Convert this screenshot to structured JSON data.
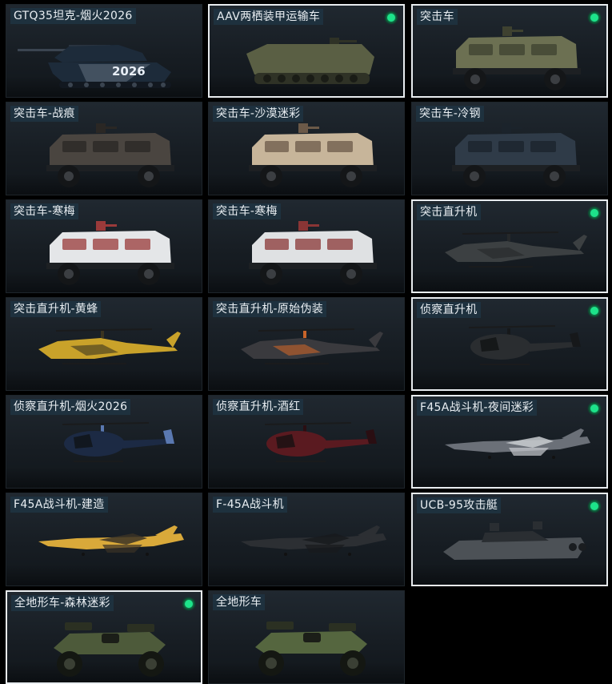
{
  "colors": {
    "card_bg": "#1b2229",
    "label_bg": "#1e3442",
    "selected_border": "#e8ecef",
    "badge": "#1de38a"
  },
  "items": [
    {
      "label": "GTQ35坦克-烟火2026",
      "selected": false,
      "badge": false,
      "icon": "tank-icon",
      "kind": "tank",
      "body": "#1d2b3a",
      "accent": "#b7c3d3",
      "decal": "2026"
    },
    {
      "label": "AAV两栖装甲运输车",
      "selected": true,
      "badge": true,
      "icon": "amphibious-carrier-icon",
      "kind": "aav",
      "body": "#5a5f44",
      "accent": "#2f3226"
    },
    {
      "label": "突击车",
      "selected": true,
      "badge": true,
      "icon": "assault-vehicle-icon",
      "kind": "truck",
      "body": "#6c7052",
      "accent": "#3e4130"
    },
    {
      "label": "突击车-战痕",
      "selected": false,
      "badge": false,
      "icon": "assault-vehicle-icon",
      "kind": "truck",
      "body": "#4a4540",
      "accent": "#2a2724"
    },
    {
      "label": "突击车-沙漠迷彩",
      "selected": false,
      "badge": false,
      "icon": "assault-vehicle-icon",
      "kind": "truck",
      "body": "#c7b59a",
      "accent": "#6b5948"
    },
    {
      "label": "突击车-冷钢",
      "selected": false,
      "badge": false,
      "icon": "assault-vehicle-icon",
      "kind": "truck",
      "body": "#2f3b48",
      "accent": "#1b232b"
    },
    {
      "label": "突击车-寒梅",
      "selected": false,
      "badge": false,
      "icon": "assault-vehicle-icon",
      "kind": "truck",
      "body": "#e4e6e8",
      "accent": "#9a3a3a"
    },
    {
      "label": "突击车-寒梅",
      "selected": false,
      "badge": false,
      "icon": "assault-vehicle-icon",
      "kind": "truck",
      "body": "#dfe1e3",
      "accent": "#8a3535"
    },
    {
      "label": "突击直升机",
      "selected": true,
      "badge": true,
      "icon": "attack-helicopter-icon",
      "kind": "heli",
      "body": "#3c4042",
      "accent": "#25282a"
    },
    {
      "label": "突击直升机-黄蜂",
      "selected": false,
      "badge": false,
      "icon": "attack-helicopter-icon",
      "kind": "heli",
      "body": "#c9a22a",
      "accent": "#3b3420"
    },
    {
      "label": "突击直升机-原始伪装",
      "selected": false,
      "badge": false,
      "icon": "attack-helicopter-icon",
      "kind": "heli",
      "body": "#3a3a3e",
      "accent": "#c9642a"
    },
    {
      "label": "侦察直升机",
      "selected": true,
      "badge": true,
      "icon": "scout-helicopter-icon",
      "kind": "scout",
      "body": "#2a2d30",
      "accent": "#16181a"
    },
    {
      "label": "侦察直升机-烟火2026",
      "selected": false,
      "badge": false,
      "icon": "scout-helicopter-icon",
      "kind": "scout",
      "body": "#1c2a44",
      "accent": "#5a78b0"
    },
    {
      "label": "侦察直升机-酒红",
      "selected": false,
      "badge": false,
      "icon": "scout-helicopter-icon",
      "kind": "scout",
      "body": "#5a1a20",
      "accent": "#2a0e12"
    },
    {
      "label": "F45A战斗机-夜间迷彩",
      "selected": true,
      "badge": true,
      "icon": "fighter-jet-icon",
      "kind": "jet",
      "body": "#6b7078",
      "accent": "#c9ccd0"
    },
    {
      "label": "F45A战斗机-建造",
      "selected": false,
      "badge": false,
      "icon": "fighter-jet-icon",
      "kind": "jet",
      "body": "#d9a93a",
      "accent": "#3a3226"
    },
    {
      "label": "F-45A战斗机",
      "selected": false,
      "badge": false,
      "icon": "fighter-jet-icon",
      "kind": "jet",
      "body": "#2c2f33",
      "accent": "#181a1d"
    },
    {
      "label": "UCB-95攻击艇",
      "selected": true,
      "badge": true,
      "icon": "attack-boat-icon",
      "kind": "boat",
      "body": "#4c5156",
      "accent": "#2a2e32"
    },
    {
      "label": "全地形车-森林迷彩",
      "selected": true,
      "badge": true,
      "icon": "atv-icon",
      "kind": "atv",
      "body": "#4d5a3a",
      "accent": "#2b3022"
    },
    {
      "label": "全地形车",
      "selected": false,
      "badge": false,
      "icon": "atv-icon",
      "kind": "atv",
      "body": "#55663f",
      "accent": "#2b3022"
    }
  ]
}
